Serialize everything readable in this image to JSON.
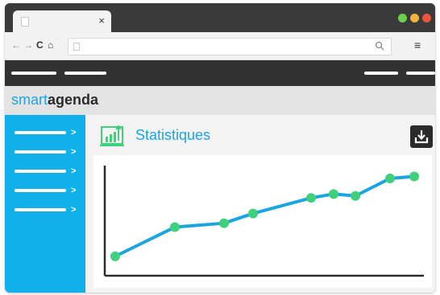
{
  "browser": {
    "tab_close": "×",
    "nav_back": "←",
    "nav_forward": "→",
    "nav_reload": "C",
    "nav_home": "⌂",
    "search_icon": "search-icon",
    "menu": "≡",
    "window_controls": [
      "#6bd14a",
      "#f3b23a",
      "#e8553c"
    ]
  },
  "brand": {
    "part1": "smart",
    "part2": "agenda"
  },
  "sidebar": {
    "items": 5
  },
  "main": {
    "title": "Statistiques",
    "title_icon": "bar-chart-icon",
    "download_icon": "download-icon"
  },
  "colors": {
    "accent": "#11b0ec",
    "line": "#1aa5e0",
    "point": "#3ed07a",
    "dark": "#323232"
  },
  "chart_data": {
    "type": "line",
    "x": [
      1,
      2,
      3,
      4,
      5,
      6,
      7,
      8,
      9
    ],
    "y": [
      5,
      20,
      22,
      27,
      35,
      37,
      36,
      45,
      46
    ],
    "ylim": [
      0,
      52
    ],
    "grid": false,
    "title": "",
    "xlabel": "",
    "ylabel": ""
  }
}
